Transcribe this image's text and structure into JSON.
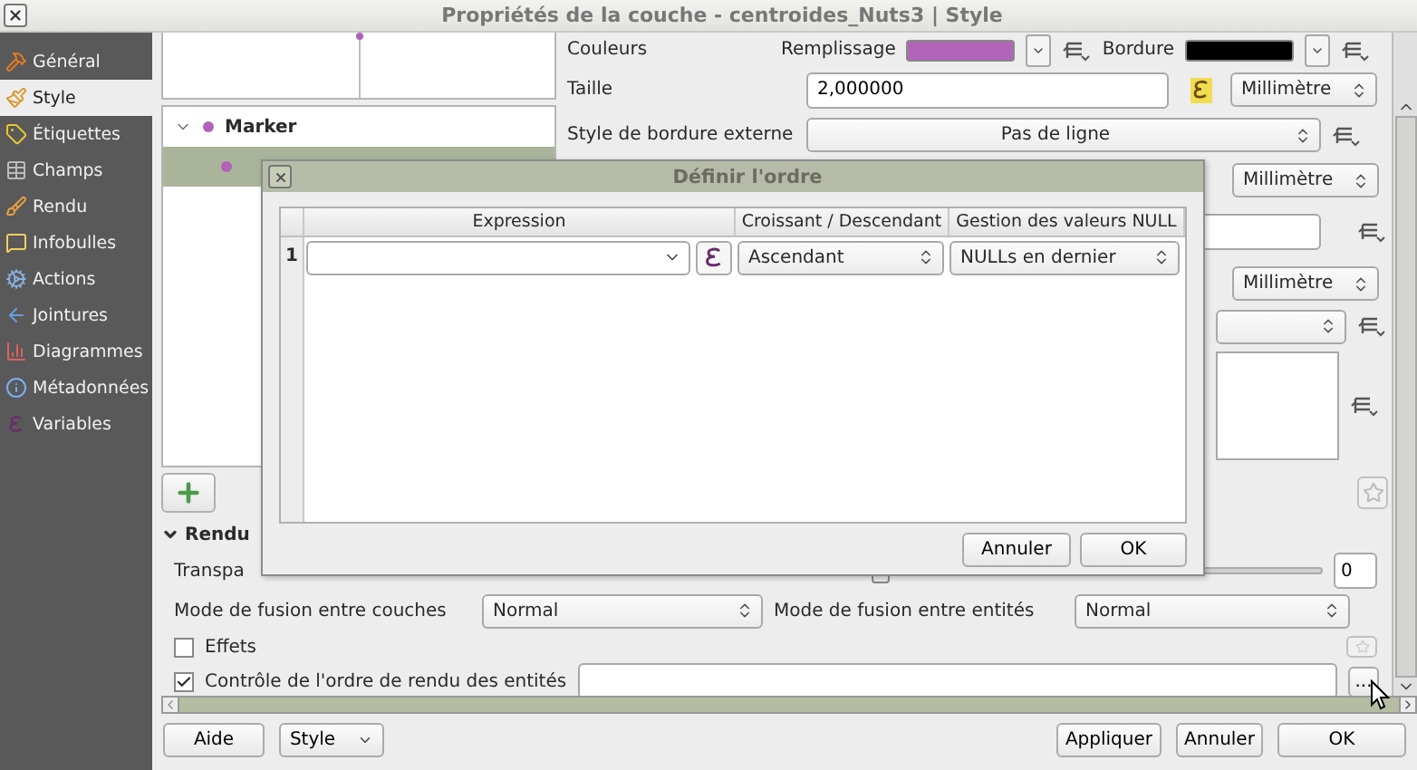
{
  "window": {
    "title": "Propriétés de la couche - centroides_Nuts3 | Style"
  },
  "sidebar": {
    "items": [
      {
        "label": "Général",
        "selected": false
      },
      {
        "label": "Style",
        "selected": true
      },
      {
        "label": "Étiquettes",
        "selected": false
      },
      {
        "label": "Champs",
        "selected": false
      },
      {
        "label": "Rendu",
        "selected": false
      },
      {
        "label": "Infobulles",
        "selected": false
      },
      {
        "label": "Actions",
        "selected": false
      },
      {
        "label": "Jointures",
        "selected": false
      },
      {
        "label": "Diagrammes",
        "selected": false
      },
      {
        "label": "Métadonnées",
        "selected": false
      },
      {
        "label": "Variables",
        "selected": false
      }
    ]
  },
  "symbol_tree": [
    {
      "label": "Marker",
      "expanded": true,
      "selected": false,
      "children": [
        {
          "selected": true
        }
      ]
    }
  ],
  "symbol_form": {
    "colors_label": "Couleurs",
    "swatches": [
      {
        "label": "Remplissage",
        "color": "#b065b8"
      },
      {
        "label": "Bordure",
        "color": "#000000"
      }
    ],
    "size_label": "Taille",
    "size_value": "2,000000",
    "size_unit": "Millimètre",
    "outline_label": "Style de bordure externe",
    "outline_value": "Pas de ligne",
    "units": [
      "Millimètre",
      "Millimètre"
    ]
  },
  "rendering": {
    "title": "Rendu",
    "expanded": true,
    "transparency_label": "Transpa",
    "level": 0,
    "transparency_value": "0",
    "layer_blend_label": "Mode de fusion entre couches",
    "layer_blend": "Normal",
    "feature_blend_label": "Mode de fusion entre entités",
    "feature_blend": "Normal",
    "effects": {
      "label": "Effets",
      "checked": false
    },
    "order_control": {
      "label": "Contrôle de l'ordre de rendu des entités",
      "checked": true,
      "button": "..."
    }
  },
  "buttons_left": [
    {
      "label": "Aide",
      "kind": "plain"
    },
    {
      "label": "Style",
      "kind": "menu"
    }
  ],
  "buttons_right": [
    "Appliquer",
    "Annuler",
    "OK"
  ],
  "dialog": {
    "title": "Définir l'ordre",
    "columns": [
      "Expression",
      "Croissant / Descendant",
      "Gestion des valeurs NULL"
    ],
    "rows": [
      {
        "number": "1",
        "order": "Ascendant",
        "nulls": "NULLs en dernier"
      }
    ],
    "buttons": [
      "Annuler",
      "OK"
    ]
  }
}
